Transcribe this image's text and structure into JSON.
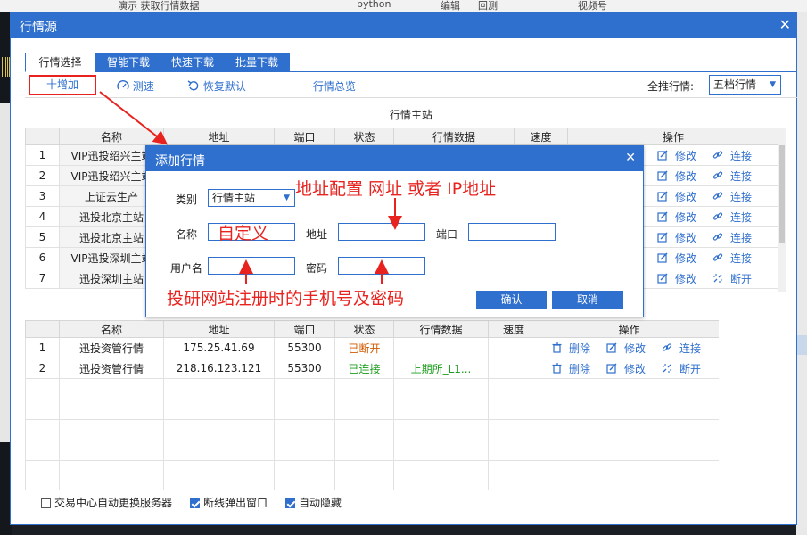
{
  "background": {
    "top_items": [
      "演示 获取行情数据",
      "python",
      "编辑",
      "回测",
      "视频号"
    ]
  },
  "window": {
    "title": "行情源",
    "close_glyph": "✕",
    "tabs": [
      "行情选择",
      "智能下载",
      "快速下载",
      "批量下载"
    ],
    "toolbar": {
      "add": "十增加",
      "speed": "测速",
      "reset": "恢复默认",
      "overview": "行情总览",
      "all_label": "全推行情:",
      "all_value": "五档行情"
    },
    "main_section_title": "行情主站",
    "main_table": {
      "headers": [
        "",
        "名称",
        "地址",
        "端口",
        "状态",
        "行情数据",
        "速度",
        "操作"
      ],
      "rows": [
        {
          "no": "1",
          "name": "VIP迅投绍兴主站",
          "ops": [
            "修改",
            "连接"
          ]
        },
        {
          "no": "2",
          "name": "VIP迅投绍兴主站",
          "ops": [
            "修改",
            "连接"
          ]
        },
        {
          "no": "3",
          "name": "上证云生产",
          "ops": [
            "修改",
            "连接"
          ]
        },
        {
          "no": "4",
          "name": "迅投北京主站",
          "ops": [
            "修改",
            "连接"
          ]
        },
        {
          "no": "5",
          "name": "迅投北京主站",
          "ops": [
            "修改",
            "连接"
          ]
        },
        {
          "no": "6",
          "name": "VIP迅投深圳主站",
          "ops": [
            "修改",
            "连接"
          ]
        },
        {
          "no": "7",
          "name": "迅投深圳主站",
          "ops": [
            "修改",
            "断开"
          ]
        }
      ]
    },
    "sub_table": {
      "headers": [
        "",
        "名称",
        "地址",
        "端口",
        "状态",
        "行情数据",
        "速度",
        "操作"
      ],
      "rows": [
        {
          "no": "1",
          "name": "迅投资管行情",
          "addr": "175.25.41.69",
          "port": "55300",
          "status": "已断开",
          "data": "",
          "ops": [
            "删除",
            "修改",
            "连接"
          ]
        },
        {
          "no": "2",
          "name": "迅投资管行情",
          "addr": "218.16.123.121",
          "port": "55300",
          "status": "已连接",
          "data": "上期所_L1...",
          "ops": [
            "删除",
            "修改",
            "断开"
          ]
        }
      ]
    },
    "footer": [
      {
        "label": "交易中心自动更换服务器",
        "checked": false
      },
      {
        "label": "断线弹出窗口",
        "checked": true
      },
      {
        "label": "自动隐藏",
        "checked": true
      }
    ]
  },
  "dialog": {
    "title": "添加行情",
    "close_glyph": "✕",
    "type_label": "类别",
    "type_value": "行情主站",
    "name_label": "名称",
    "addr_label": "地址",
    "port_label": "端口",
    "user_label": "用户名",
    "pwd_label": "密码",
    "ok": "确认",
    "cancel": "取消"
  },
  "annotations": {
    "addr_note": "地址配置 网址 或者 IP地址",
    "name_note": "自定义",
    "account_note": "投研网站注册时的手机号及密码"
  },
  "colors": {
    "accent": "#2f6fce",
    "annotation": "#e8231f",
    "status_off": "#d25a00",
    "status_on": "#1d9d1d"
  }
}
